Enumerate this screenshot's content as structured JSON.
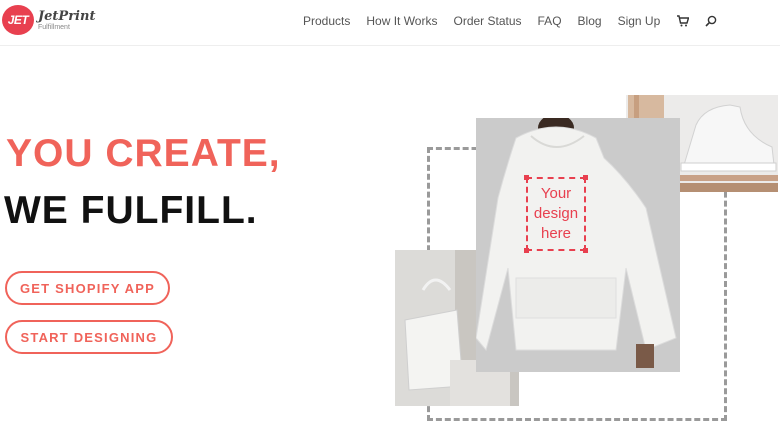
{
  "brand": {
    "badge": "JET",
    "name": "JetPrint",
    "sub": "Fulfillment"
  },
  "nav": {
    "items": [
      "Products",
      "How It Works",
      "Order Status",
      "FAQ",
      "Blog",
      "Sign Up"
    ]
  },
  "hero": {
    "headline_line1": "YOU CREATE,",
    "headline_line2": "WE FULFILL.",
    "buttons": [
      "GET SHOPIFY APP",
      "START DESIGNING"
    ]
  },
  "design_placeholder": {
    "line1": "Your",
    "line2": "design",
    "line3": "here"
  },
  "colors": {
    "accent": "#f0635a",
    "brand_red": "#e8404f",
    "dark": "#111111"
  },
  "icons": [
    "cart-icon",
    "search-icon"
  ]
}
